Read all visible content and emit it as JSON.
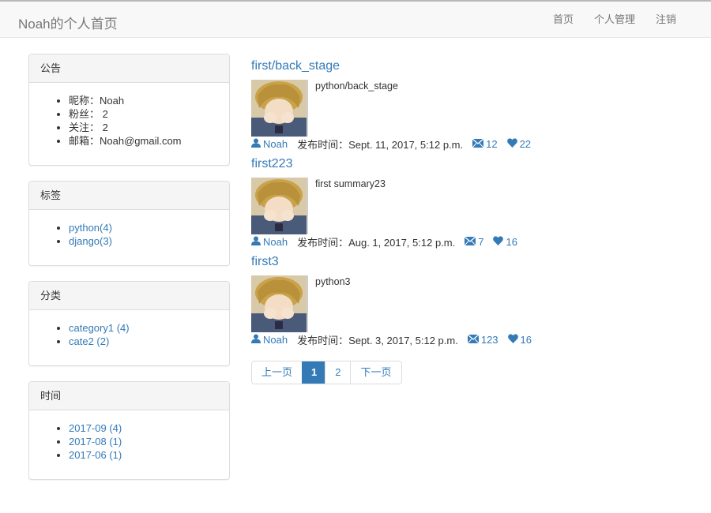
{
  "navbar": {
    "brand": "Noah的个人首页",
    "links": [
      "首页",
      "个人管理",
      "注销"
    ]
  },
  "sidebar": {
    "announcement": {
      "title": "公告",
      "items": [
        "昵称：Noah",
        "粉丝： 2",
        "关注： 2",
        "邮箱：Noah@gmail.com"
      ]
    },
    "tags": {
      "title": "标签",
      "items": [
        "python(4)",
        "django(3)"
      ]
    },
    "categories": {
      "title": "分类",
      "items": [
        "category1 (4)",
        "cate2 (2)"
      ]
    },
    "archive": {
      "title": "时间",
      "items": [
        "2017-09 (4)",
        "2017-08 (1)",
        "2017-06 (1)"
      ]
    }
  },
  "posts": [
    {
      "title": "first/back_stage",
      "summary": "python/back_stage",
      "author": "Noah",
      "date": "发布时间：Sept. 11, 2017, 5:12 p.m.",
      "comments": "12",
      "likes": "22"
    },
    {
      "title": "first223",
      "summary": "first summary23",
      "author": "Noah",
      "date": "发布时间：Aug. 1, 2017, 5:12 p.m.",
      "comments": "7",
      "likes": "16"
    },
    {
      "title": "first3",
      "summary": "python3",
      "author": "Noah",
      "date": "发布时间：Sept. 3, 2017, 5:12 p.m.",
      "comments": "123",
      "likes": "16"
    }
  ],
  "pagination": {
    "prev": "上一页",
    "pages": [
      "1",
      "2"
    ],
    "current": "1",
    "next": "下一页"
  },
  "colors": {
    "link": "#337ab7",
    "navbar_bg": "#f8f8f8",
    "panel_heading_bg": "#f5f5f5"
  },
  "icons": {
    "author": "user-icon",
    "comments": "envelope-icon",
    "likes": "heart-icon"
  }
}
